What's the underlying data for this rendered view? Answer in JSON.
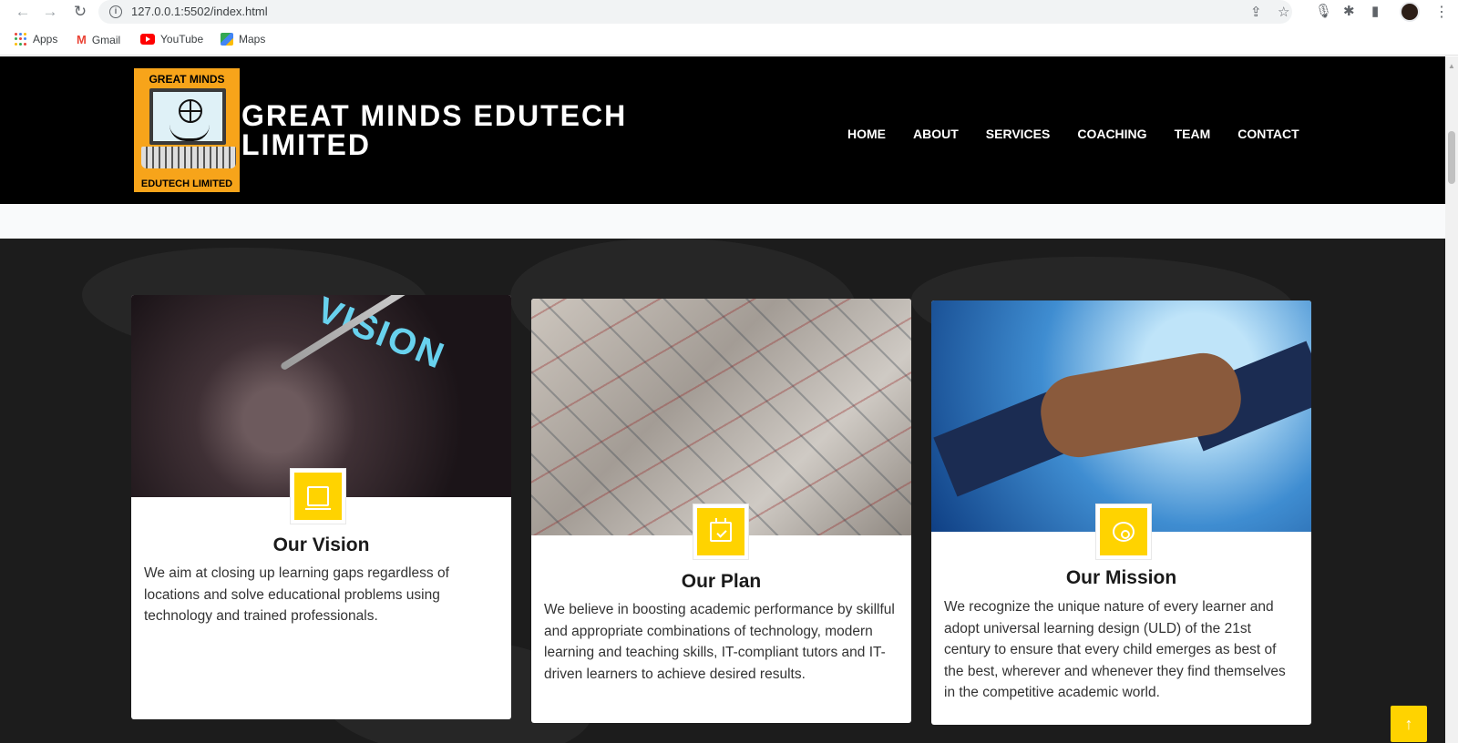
{
  "browser": {
    "url": "127.0.0.1:5502/index.html",
    "icons": {
      "back": "arrow-left-icon",
      "forward": "arrow-right-icon",
      "reload": "reload-icon",
      "info": "info-icon",
      "share": "share-icon",
      "bookmark": "star-icon",
      "mic": "microphone-icon",
      "extensions": "puzzle-icon",
      "side_panel": "side-panel-icon",
      "profile": "avatar",
      "menu": "kebab-menu-icon"
    },
    "bookmarks": [
      {
        "label": "Apps",
        "icon": "apps-grid-icon"
      },
      {
        "label": "Gmail",
        "icon": "gmail-icon"
      },
      {
        "label": "YouTube",
        "icon": "youtube-icon"
      },
      {
        "label": "Maps",
        "icon": "maps-icon"
      }
    ]
  },
  "header": {
    "logo": {
      "top_text": "GREAT MINDS",
      "bottom_text": "EDUTECH LIMITED"
    },
    "title_line1": "GREAT MINDS EDUTECH",
    "title_line2": "LIMITED",
    "nav": [
      "HOME",
      "ABOUT",
      "SERVICES",
      "COACHING",
      "TEAM",
      "CONTACT"
    ]
  },
  "cards": [
    {
      "title": "Our Vision",
      "icon": "monitor-icon",
      "image": "compass-vision-image",
      "image_text": "VISION",
      "text": "We aim at closing up learning gaps regardless of locations and solve educational problems using technology and trained professionals."
    },
    {
      "title": "Our Plan",
      "icon": "calendar-check-icon",
      "image": "sketch-plan-image",
      "text": "We believe in boosting academic performance by skillful and appropriate combinations of technology, modern learning and teaching skills, IT-compliant tutors and IT-driven learners to achieve desired results."
    },
    {
      "title": "Our Mission",
      "icon": "film-reel-icon",
      "image": "handshake-image",
      "text": "We recognize the unique nature of every learner and adopt universal learning design (ULD) of the 21st century to ensure that every child emerges as best of the best, wherever and whenever they find themselves in the competitive academic world."
    }
  ],
  "back_to_top": {
    "icon": "arrow-up-icon",
    "label": "↑"
  },
  "colors": {
    "accent": "#ffd300",
    "header_bg": "#000000",
    "section_bg": "#1c1c1c",
    "logo_bg": "#f7a41a"
  }
}
